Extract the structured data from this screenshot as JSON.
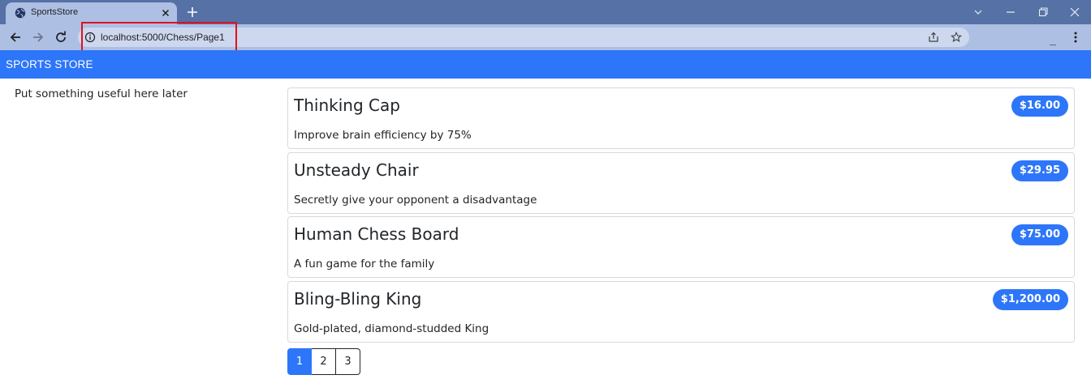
{
  "browser": {
    "tab_title": "SportsStore",
    "url": "localhost:5000/Chess/Page1",
    "icons": [
      "globe-icon",
      "close-icon",
      "plus-icon",
      "chevron-down-icon",
      "minimize-icon",
      "restore-icon",
      "close-window-icon",
      "back-arrow-icon",
      "forward-arrow-icon",
      "reload-icon",
      "info-icon",
      "share-icon",
      "star-icon",
      "kebab-menu-icon"
    ]
  },
  "navbar": {
    "brand": "SPORTS STORE",
    "color": "#2d76f9"
  },
  "sidebar": {
    "text": "Put something useful here later"
  },
  "products": [
    {
      "name": "Thinking Cap",
      "price": "$16.00",
      "description": "Improve brain efficiency by 75%"
    },
    {
      "name": "Unsteady Chair",
      "price": "$29.95",
      "description": "Secretly give your opponent a disadvantage"
    },
    {
      "name": "Human Chess Board",
      "price": "$75.00",
      "description": "A fun game for the family"
    },
    {
      "name": "Bling-Bling King",
      "price": "$1,200.00",
      "description": "Gold-plated, diamond-studded King"
    }
  ],
  "pagination": {
    "pages": [
      "1",
      "2",
      "3"
    ],
    "current": "1"
  },
  "colors": {
    "accent": "#2d76f9",
    "chrome_dark": "#5571a6",
    "chrome_light": "#adbfe3",
    "highlight": "#e0121b"
  }
}
